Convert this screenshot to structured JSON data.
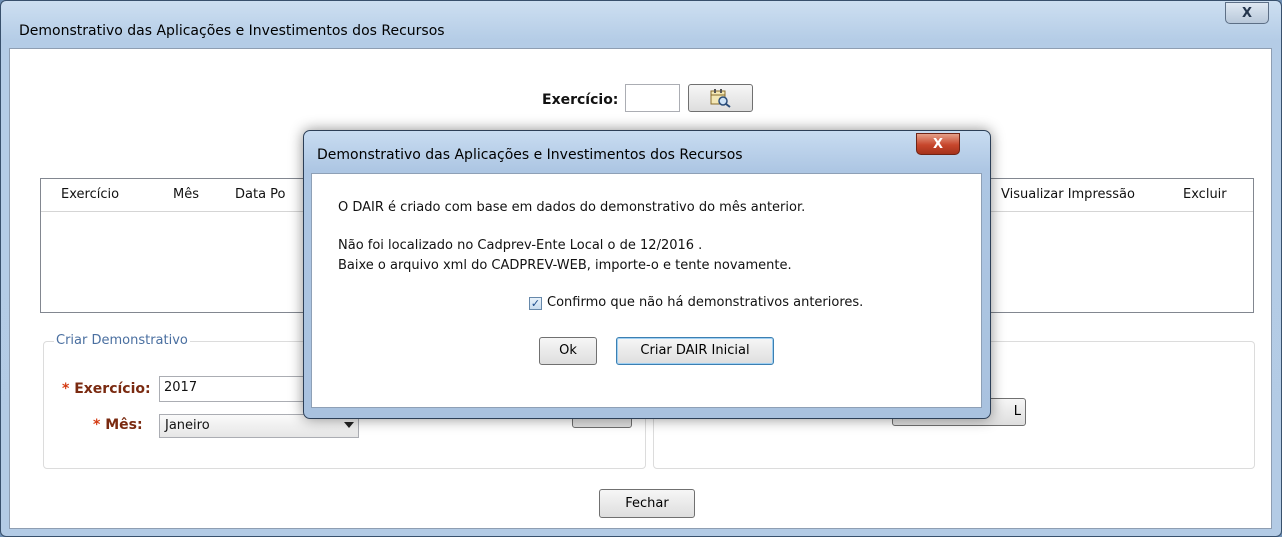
{
  "window": {
    "title": "Demonstrativo das Aplicações e Investimentos dos Recursos",
    "close_label": "X"
  },
  "filter": {
    "exercicio_label": "Exercício:",
    "exercicio_value": "",
    "search_icon": "search-calendar-icon"
  },
  "table": {
    "headers": [
      "Exercício",
      "Mês",
      "Data Po",
      "Visualizar Impressão",
      "Excluir"
    ]
  },
  "criar": {
    "legend": "Criar Demonstrativo",
    "exercicio_label": "Exercício:",
    "exercicio_value": "2017",
    "mes_label": "Mês:",
    "mes_value": "Janeiro",
    "required_mark": "*"
  },
  "import_panel": {
    "button_partial": "L"
  },
  "footer": {
    "fechar_label": "Fechar"
  },
  "dialog": {
    "title": "Demonstrativo das Aplicações e Investimentos dos Recursos",
    "close_label": "X",
    "line1": "O DAIR é criado com base em dados do demonstrativo do mês anterior.",
    "line2": "Não foi localizado no Cadprev-Ente Local o de 12/2016 .",
    "line3": "Baixe o arquivo xml do CADPREV-WEB, importe-o e tente novamente.",
    "checkbox_label": "Confirmo que não há demonstrativos anteriores.",
    "checkbox_checked": true,
    "ok_label": "Ok",
    "criar_label": "Criar DAIR Inicial"
  }
}
